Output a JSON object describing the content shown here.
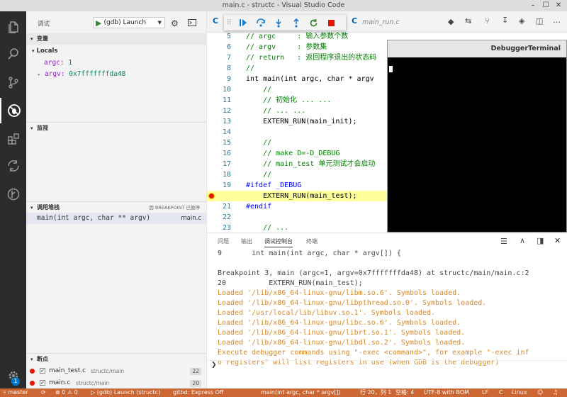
{
  "window": {
    "title": "main.c - structc - Visual Studio Code"
  },
  "debug": {
    "header_label": "调试",
    "config_name": "(gdb) Launch",
    "variables_title": "变量",
    "locals_label": "Locals",
    "variables": [
      {
        "name": "argc",
        "value": "1"
      },
      {
        "name": "argv",
        "value": "0x7fffffffda48"
      }
    ],
    "watch_title": "监视",
    "callstack_title": "调用堆栈",
    "callstack_status": "因 BREAKPOINT 已暂停",
    "callstack_frames": [
      {
        "name": "main(int argc, char ** argv)",
        "file": "main.c"
      }
    ],
    "breakpoints_title": "断点",
    "breakpoints": [
      {
        "file": "main_test.c",
        "path": "structc/main",
        "line": "22"
      },
      {
        "file": "main.c",
        "path": "structc/main",
        "line": "20"
      }
    ]
  },
  "editor": {
    "tabs": [
      {
        "label": "main_run.c"
      }
    ],
    "lines": [
      {
        "n": "5",
        "text": "// argc     : 输入参数个数",
        "kind": "cm"
      },
      {
        "n": "6",
        "text": "// argv     : 参数集",
        "kind": "cm"
      },
      {
        "n": "7",
        "text": "// return   : 返回程序退出的状态码",
        "kind": "cm"
      },
      {
        "n": "8",
        "text": "//",
        "kind": "cm"
      },
      {
        "n": "9",
        "text": "int main(int argc, char * argv",
        "kind": "sig"
      },
      {
        "n": "10",
        "text": "    //",
        "kind": "cm"
      },
      {
        "n": "11",
        "text": "    // 初始化 ... ...",
        "kind": "cm"
      },
      {
        "n": "12",
        "text": "    // ... ...",
        "kind": "cm"
      },
      {
        "n": "13",
        "text": "    EXTERN_RUN(main_init);",
        "kind": "code"
      },
      {
        "n": "14",
        "text": "",
        "kind": "code"
      },
      {
        "n": "15",
        "text": "    //",
        "kind": "cm"
      },
      {
        "n": "16",
        "text": "    // make D=-D_DEBUG",
        "kind": "cm"
      },
      {
        "n": "17",
        "text": "    // main_test 单元测试才会启动",
        "kind": "cm"
      },
      {
        "n": "18",
        "text": "    //",
        "kind": "cm"
      },
      {
        "n": "19",
        "text": "#ifdef _DEBUG",
        "kind": "pp"
      },
      {
        "n": "20",
        "text": "    EXTERN_RUN(main_test);",
        "kind": "hl"
      },
      {
        "n": "21",
        "text": "#endif",
        "kind": "pp"
      },
      {
        "n": "22",
        "text": "",
        "kind": "code"
      },
      {
        "n": "23",
        "text": "    // ...",
        "kind": "cm"
      }
    ]
  },
  "terminal": {
    "title": "DebuggerTerminal"
  },
  "panel": {
    "tabs": [
      {
        "label": "问题"
      },
      {
        "label": "输出"
      },
      {
        "label": "调试控制台"
      },
      {
        "label": "终端"
      }
    ],
    "lines": [
      {
        "text": "9       int main(int argc, char * argv[]) {",
        "warn": false
      },
      {
        "text": "",
        "warn": false
      },
      {
        "text": "Breakpoint 3, main (argc=1, argv=0x7fffffffda48) at structc/main/main.c:2",
        "warn": false
      },
      {
        "text": "20          EXTERN_RUN(main_test);",
        "warn": false
      },
      {
        "text": "Loaded '/lib/x86_64-linux-gnu/libm.so.6'. Symbols loaded.",
        "warn": true
      },
      {
        "text": "Loaded '/lib/x86_64-linux-gnu/libpthread.so.0'. Symbols loaded.",
        "warn": true
      },
      {
        "text": "Loaded '/usr/local/lib/libuv.so.1'. Symbols loaded.",
        "warn": true
      },
      {
        "text": "Loaded '/lib/x86_64-linux-gnu/libc.so.6'. Symbols loaded.",
        "warn": true
      },
      {
        "text": "Loaded '/lib/x86_64-linux-gnu/librt.so.1'. Symbols loaded.",
        "warn": true
      },
      {
        "text": "Loaded '/lib/x86_64-linux-gnu/libdl.so.2'. Symbols loaded.",
        "warn": true
      },
      {
        "text": "Execute debugger commands using \"-exec <command>\", for example \"-exec inf",
        "warn": true
      },
      {
        "text": "o registers\" will list registers in use (when GDB is the debugger)",
        "warn": true
      }
    ],
    "prompt": "❯"
  },
  "status": {
    "branch": "master",
    "problems": "0",
    "warnings": "0",
    "launch": "(gdb) Launch (structc)",
    "gitbd": "gitbd: Express Off",
    "function": "main(int argc, char * argv[])",
    "position": "行 20，列 1",
    "spaces": "空格: 4",
    "encoding": "UTF-8 with BOM",
    "eol": "LF",
    "language": "C",
    "platform": "Linux"
  },
  "colors": {
    "statusbar": "#cc6633",
    "breakpoint": "#e51400",
    "current_line": "#ffff9e",
    "warning_text": "#d48a2c"
  }
}
